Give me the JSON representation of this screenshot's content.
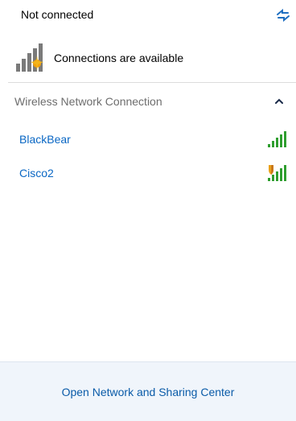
{
  "header": {
    "status": "Not connected",
    "refresh_icon": "refresh-arrows-icon"
  },
  "connection": {
    "icon": "network-bars-star-icon",
    "message": "Connections are available"
  },
  "section": {
    "label": "Wireless Network Connection",
    "collapse_icon": "chevron-up-icon"
  },
  "networks": [
    {
      "name": "BlackBear",
      "icon": "signal-strength-icon",
      "secured": false
    },
    {
      "name": "Cisco2",
      "icon": "signal-strength-shield-icon",
      "secured": true
    }
  ],
  "footer": {
    "link": "Open Network and Sharing Center"
  },
  "colors": {
    "link_blue": "#0a67c4",
    "signal_green": "#2f9e2f",
    "star_orange": "#f3a20b",
    "footer_bg": "#f0f5fb"
  }
}
